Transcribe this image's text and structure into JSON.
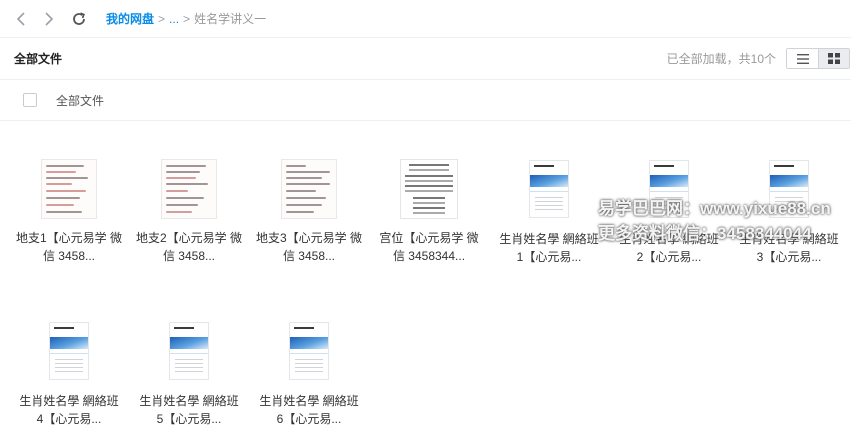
{
  "nav": {
    "back_icon": "chevron-left-icon",
    "forward_icon": "chevron-right-icon",
    "refresh_icon": "refresh-icon"
  },
  "breadcrumb": {
    "root": "我的网盘",
    "sep1": ">",
    "ellipsis": "...",
    "sep2": ">",
    "current": "姓名学讲义一"
  },
  "header": {
    "title": "全部文件",
    "status": "已全部加载，共10个"
  },
  "select_all": {
    "label": "全部文件"
  },
  "files": [
    {
      "name": "地支1【心元易学 微信 3458...",
      "type": "handwritten"
    },
    {
      "name": "地支2【心元易学 微信 3458...",
      "type": "handwritten"
    },
    {
      "name": "地支3【心元易学 微信 3458...",
      "type": "handwritten"
    },
    {
      "name": "宫位【心元易学 微信 3458344...",
      "type": "document"
    },
    {
      "name": "生肖姓名學 網絡班 1【心元易...",
      "type": "slide"
    },
    {
      "name": "生肖姓名學 網絡班 2【心元易...",
      "type": "slide"
    },
    {
      "name": "生肖姓名學 網絡班 3【心元易...",
      "type": "slide"
    },
    {
      "name": "生肖姓名學 網絡班 4【心元易...",
      "type": "slide"
    },
    {
      "name": "生肖姓名學 網絡班 5【心元易...",
      "type": "slide"
    },
    {
      "name": "生肖姓名學 網絡班 6【心元易...",
      "type": "slide"
    }
  ],
  "watermark": {
    "line1": "易学巴巴网：www.yixue88.cn",
    "line2": "更多资料微信：3458344044"
  }
}
